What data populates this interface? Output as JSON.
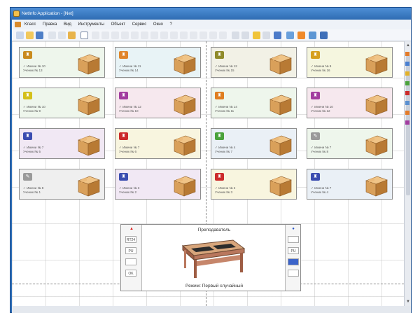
{
  "window": {
    "title": "NetInfo Application - [Net]"
  },
  "menu": {
    "items": [
      "Класс",
      "Правка",
      "Вид",
      "Инструменты",
      "Объект",
      "Сервис",
      "Окно",
      "?"
    ]
  },
  "stations": [
    {
      "status": "✓ Имени № 10",
      "name": "Ученик № 13",
      "avatar_color": "#c98b1e",
      "avatar_glyph": "♜",
      "bg": "#eef6ec"
    },
    {
      "status": "✓ Имени № 11",
      "name": "Ученик № 14",
      "avatar_color": "#e0852b",
      "avatar_glyph": "♜",
      "bg": "#e8f3f6"
    },
    {
      "status": "✓ Имени № 12",
      "name": "Ученик № 15",
      "avatar_color": "#8f8a2a",
      "avatar_glyph": "♜",
      "bg": "#f2f1e6"
    },
    {
      "status": "✓ Имени № 9",
      "name": "Ученик № 16",
      "avatar_color": "#d6a01c",
      "avatar_glyph": "♜",
      "bg": "#f5f6df"
    },
    {
      "status": "✓ Имени № 10",
      "name": "Ученик № 9",
      "avatar_color": "#d4c01a",
      "avatar_glyph": "♜",
      "bg": "#eef6ec"
    },
    {
      "status": "✓ Имени № 12",
      "name": "Ученик № 10",
      "avatar_color": "#a23c9f",
      "avatar_glyph": "♜",
      "bg": "#f6e8ee"
    },
    {
      "status": "✓ Имени № 14",
      "name": "Ученик № 11",
      "avatar_color": "#e07d1f",
      "avatar_glyph": "♜",
      "bg": "#eef6ec"
    },
    {
      "status": "✓ Имени № 10",
      "name": "Ученик № 12",
      "avatar_color": "#a23c9f",
      "avatar_glyph": "♜",
      "bg": "#f6e8ee"
    },
    {
      "status": "✓ Имени № 7",
      "name": "Ученик № 5",
      "avatar_color": "#3b4db0",
      "avatar_glyph": "♜",
      "bg": "#f1e8f4"
    },
    {
      "status": "✓ Имени № 7",
      "name": "Ученик № 6",
      "avatar_color": "#cc2a2a",
      "avatar_glyph": "♜",
      "bg": "#f8f5df"
    },
    {
      "status": "✓ Имени № 4",
      "name": "Ученик № 7",
      "avatar_color": "#4aa23b",
      "avatar_glyph": "♜",
      "bg": "#eaf0f6"
    },
    {
      "status": "✓ Имени № 7",
      "name": "Ученик № 8",
      "avatar_color": "#9a9a9a",
      "avatar_glyph": "✎",
      "bg": "#eef6ec"
    },
    {
      "status": "✓ Имени № 8",
      "name": "Ученик № 1",
      "avatar_color": "#9a9a9a",
      "avatar_glyph": "✎",
      "bg": "#efefef"
    },
    {
      "status": "✓ Имени № 3",
      "name": "Ученик № 2",
      "avatar_color": "#3b4db0",
      "avatar_glyph": "♜",
      "bg": "#f1e8f4"
    },
    {
      "status": "✓ Имени № 2",
      "name": "Ученик № 3",
      "avatar_color": "#cc2a2a",
      "avatar_glyph": "♜",
      "bg": "#f8f5df"
    },
    {
      "status": "✓ Имени № 7",
      "name": "Ученик № 4",
      "avatar_color": "#3b4db0",
      "avatar_glyph": "♜",
      "bg": "#eaf0f6"
    }
  ],
  "teacher": {
    "title": "Преподаватель",
    "mode": "Режим: Первый случайный",
    "left_mark": "▲",
    "right_mark": "●",
    "left_buttons": [
      "RT24",
      "PU",
      "",
      "OK"
    ],
    "right_buttons": [
      "",
      "PU",
      "",
      ""
    ]
  },
  "colors": {
    "titlebar": "#2e6cb3",
    "box_light": "#e7b36a",
    "box_dark": "#b87a34"
  },
  "icons": [
    "app-icon",
    "menu-icon",
    "scroll-up-icon",
    "scroll-down-icon",
    "box-icon"
  ]
}
